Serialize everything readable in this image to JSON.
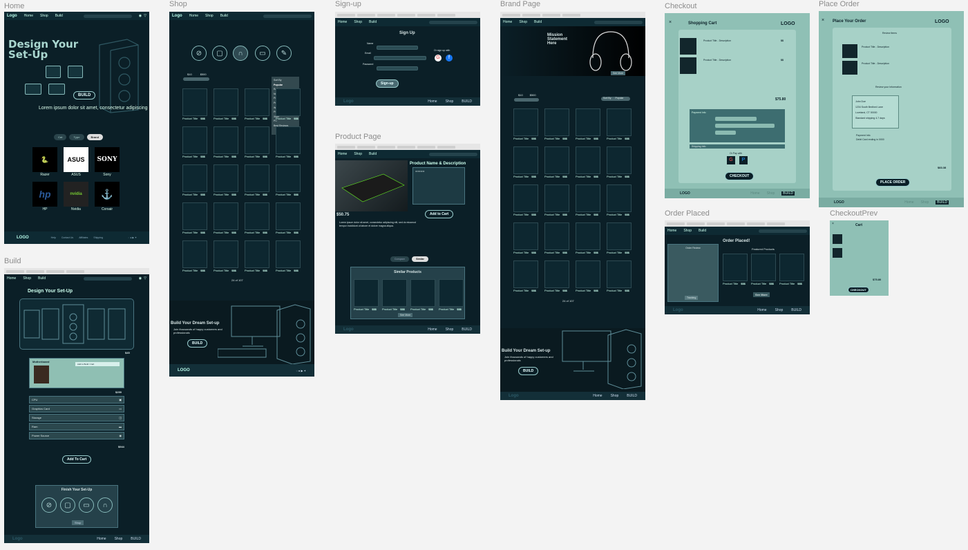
{
  "frames": {
    "home": "Home",
    "build": "Build",
    "shop": "Shop",
    "signup": "Sign-up",
    "product": "Product Page",
    "brand": "Brand Page",
    "checkout": "Checkout",
    "place_order": "Place Order",
    "order_placed": "Order Placed",
    "checkout_prev": "CheckoutPrev"
  },
  "nav": {
    "logo": "Logo",
    "home": "Home",
    "shop": "Shop",
    "build": "Build",
    "logo_upper": "LOGO",
    "build_upper": "BUILD"
  },
  "home": {
    "hero_line1": "Design Your",
    "hero_line2": "Set-Up",
    "build_btn": "BUILD",
    "lorem": "Lorem ipsum dolor sit amet, consectetur adipiscing",
    "filters": [
      "Cat",
      "Type",
      "Brand"
    ],
    "brands": [
      {
        "name": "Razer",
        "mark": "🐍"
      },
      {
        "name": "ASUS",
        "mark": "ASUS"
      },
      {
        "name": "Sony",
        "mark": "SONY"
      },
      {
        "name": "HP",
        "mark": "hp"
      },
      {
        "name": "Nvidia",
        "mark": "nvidia"
      },
      {
        "name": "Corsair",
        "mark": "⚓"
      }
    ],
    "footer_links": [
      "Help",
      "Contact Us",
      "Affiliates",
      "Shipping",
      "Privacy",
      "Investors"
    ]
  },
  "build": {
    "title": "Design Your Set-Up",
    "price_case": "$45",
    "motherboard": "Motherboard",
    "mb_btn": "Add to Build / Cart",
    "price_mb": "$299",
    "parts": [
      "CPU",
      "Graphics Card",
      "Storage",
      "Ram",
      "Power Source"
    ],
    "price_parts": "$944",
    "add_to_cart": "Add To Cart",
    "finish": "Finish Your Set-Up",
    "shop_btn": "Shop"
  },
  "shop": {
    "price_min": "$10",
    "price_max": "$500",
    "sort_label": "Sort By",
    "sort_options": [
      "Popular",
      "Rating",
      "New",
      "Price - High to Low",
      "Price - Low to High",
      "Wireless",
      "PC",
      "Xbox",
      "PC",
      "Best Reviews"
    ],
    "product_title": "Product Title",
    "price": "$$$",
    "pagination": "24 of 107",
    "cta_title": "Build Your Dream Set-up",
    "cta_sub": "Join thousands of happy customers and professionals",
    "cta_btn": "BUILD"
  },
  "signup": {
    "title": "Sign Up",
    "name": "Name",
    "email": "Email",
    "password": "Password",
    "or": "Or sign up with",
    "btn": "Sign-up"
  },
  "product": {
    "title": "Product Name & Description",
    "price": "$50.75",
    "add": "Add to Cart",
    "lorem": "Lorem ipsum dolor sit amet, consectetur adipiscing elit, sed do eiusmod tempor incididunt ut labore et dolore magna aliqua.",
    "tabs": [
      "Compare",
      "Similar"
    ],
    "similar": "Similar Products",
    "see_more": "See More"
  },
  "brand": {
    "mission": "Mission Statement Here",
    "see_more": "See More",
    "sort": "Sort By",
    "popular": "Popular"
  },
  "checkout": {
    "title": "Shopping Cart",
    "logo": "LOGO",
    "item": "Product Title - Description",
    "qty": "1",
    "price": "$$",
    "total": "$75.80",
    "payment": "Payment Info",
    "shipping": "Shipping Info",
    "or_pay": "Or Pay with",
    "btn": "CHECKOUT"
  },
  "place_order": {
    "title": "Place Your Order",
    "review": "Review Items",
    "review_info": "Review your Information",
    "name": "John Doe",
    "address": "1234 South Bedford Lane",
    "city": "Loveland, CT 00000",
    "shipping": "Standard shipping 4-7 days",
    "payment": "Payment Info",
    "card": "Debit Card ending in 0000",
    "total": "$83.38",
    "btn": "PLACE ORDER"
  },
  "order_placed": {
    "review": "Order Review",
    "title": "Order Placed!",
    "featured": "Featured Products",
    "tracking": "Tracking",
    "see_more": "See More"
  },
  "cart_prev": {
    "title": "Cart",
    "total": "$75.80",
    "btn": "CHECKOUT"
  },
  "colors": {
    "dark": "#0b1f27",
    "teal": "#8fc0b5",
    "accent": "#bfe"
  }
}
